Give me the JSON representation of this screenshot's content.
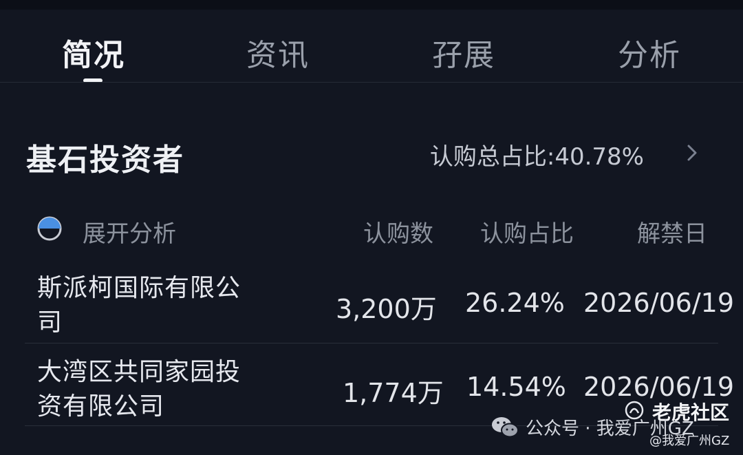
{
  "tabs": [
    {
      "label": "简况",
      "active": true
    },
    {
      "label": "资讯",
      "active": false
    },
    {
      "label": "孖展",
      "active": false
    },
    {
      "label": "分析",
      "active": false
    }
  ],
  "section": {
    "title": "基石投资者",
    "subscription_ratio_text": "认购总占比:40.78%"
  },
  "table": {
    "expand_label": "展开分析",
    "headers": [
      "认购数",
      "认购占比",
      "解禁日"
    ],
    "rows": [
      {
        "name": "斯派柯国际有限公司",
        "amount": "3,200万",
        "ratio": "26.24%",
        "unlock_date": "2026/06/19"
      },
      {
        "name": "大湾区共同家园投资有限公司",
        "amount": "1,774万",
        "ratio": "14.54%",
        "unlock_date": "2026/06/19"
      }
    ]
  },
  "watermark": {
    "tiger": "老虎社区",
    "wechat": "公众号 · 我爱广州GZ",
    "sub": "@我爱广州GZ"
  },
  "colors": {
    "background": "#121621",
    "accent": "#4a90e2"
  }
}
